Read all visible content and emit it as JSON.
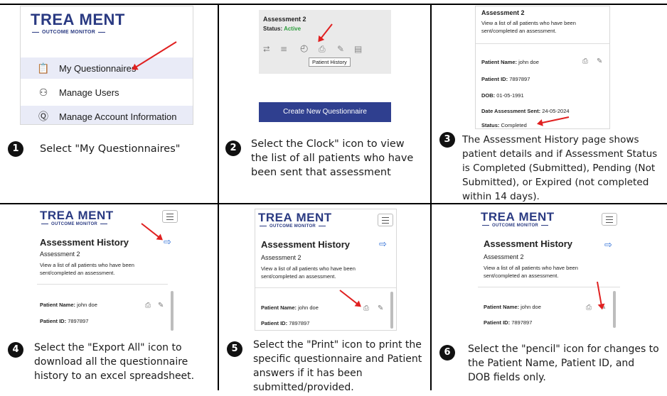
{
  "logo": {
    "main": "TREA MENT",
    "sub": "OUTCOME MONITOR"
  },
  "panel1": {
    "menu": [
      {
        "label": "My Questionnaires",
        "icon": "clipboard-icon"
      },
      {
        "label": "Manage Users",
        "icon": "users-icon"
      },
      {
        "label": "Manage Account Information",
        "icon": "account-icon"
      }
    ],
    "step": "1",
    "text": "Select \"My Questionnaires\""
  },
  "panel2": {
    "card_title": "Assessment 2",
    "status_label": "Status:",
    "status_value": "Active",
    "tooltip": "Patient History",
    "button": "Create New Questionnaire",
    "step": "2",
    "text": "Select the Clock\" icon to view the list of all patients who have been sent that assessment"
  },
  "panel3": {
    "card_title": "Assessment 2",
    "desc": "View a list of all patients who have been sent/completed an assessment.",
    "patient_name_label": "Patient Name:",
    "patient_name": "john doe",
    "patient_id_label": "Patient ID:",
    "patient_id": "7897897",
    "dob_label": "DOB:",
    "dob": "01-05-1991",
    "sent_label": "Date Assessment Sent:",
    "sent": "24-05-2024",
    "status_label": "Status:",
    "status": "Completed",
    "step": "3",
    "text": "The Assessment History page shows patient details and if Assessment Status is Completed (Submitted), Pending (Not Submitted), or Expired (not completed within 14 days)."
  },
  "history": {
    "title": "Assessment History",
    "subtitle": "Assessment 2",
    "desc": "View a list of all patients who have been sent/completed an assessment.",
    "patient_name_label": "Patient Name:",
    "patient_name": "john doe",
    "patient_id_label": "Patient ID:",
    "patient_id": "7897897"
  },
  "panel4": {
    "step": "4",
    "text": "Select the \"Export All\" icon to download all the questionnaire history to an excel spreadsheet."
  },
  "panel5": {
    "step": "5",
    "text": "Select the \"Print\" icon to print the specific questionnaire and Patient answers if it has been submitted/provided."
  },
  "panel6": {
    "step": "6",
    "text": "Select the \"pencil\" icon for changes to the Patient Name, Patient ID, and DOB fields only."
  },
  "colors": {
    "brand": "#2a3a82",
    "active": "#2e9e3e",
    "arrow": "#e02020",
    "button": "#2f3f8f",
    "export": "#2f6fd6"
  }
}
